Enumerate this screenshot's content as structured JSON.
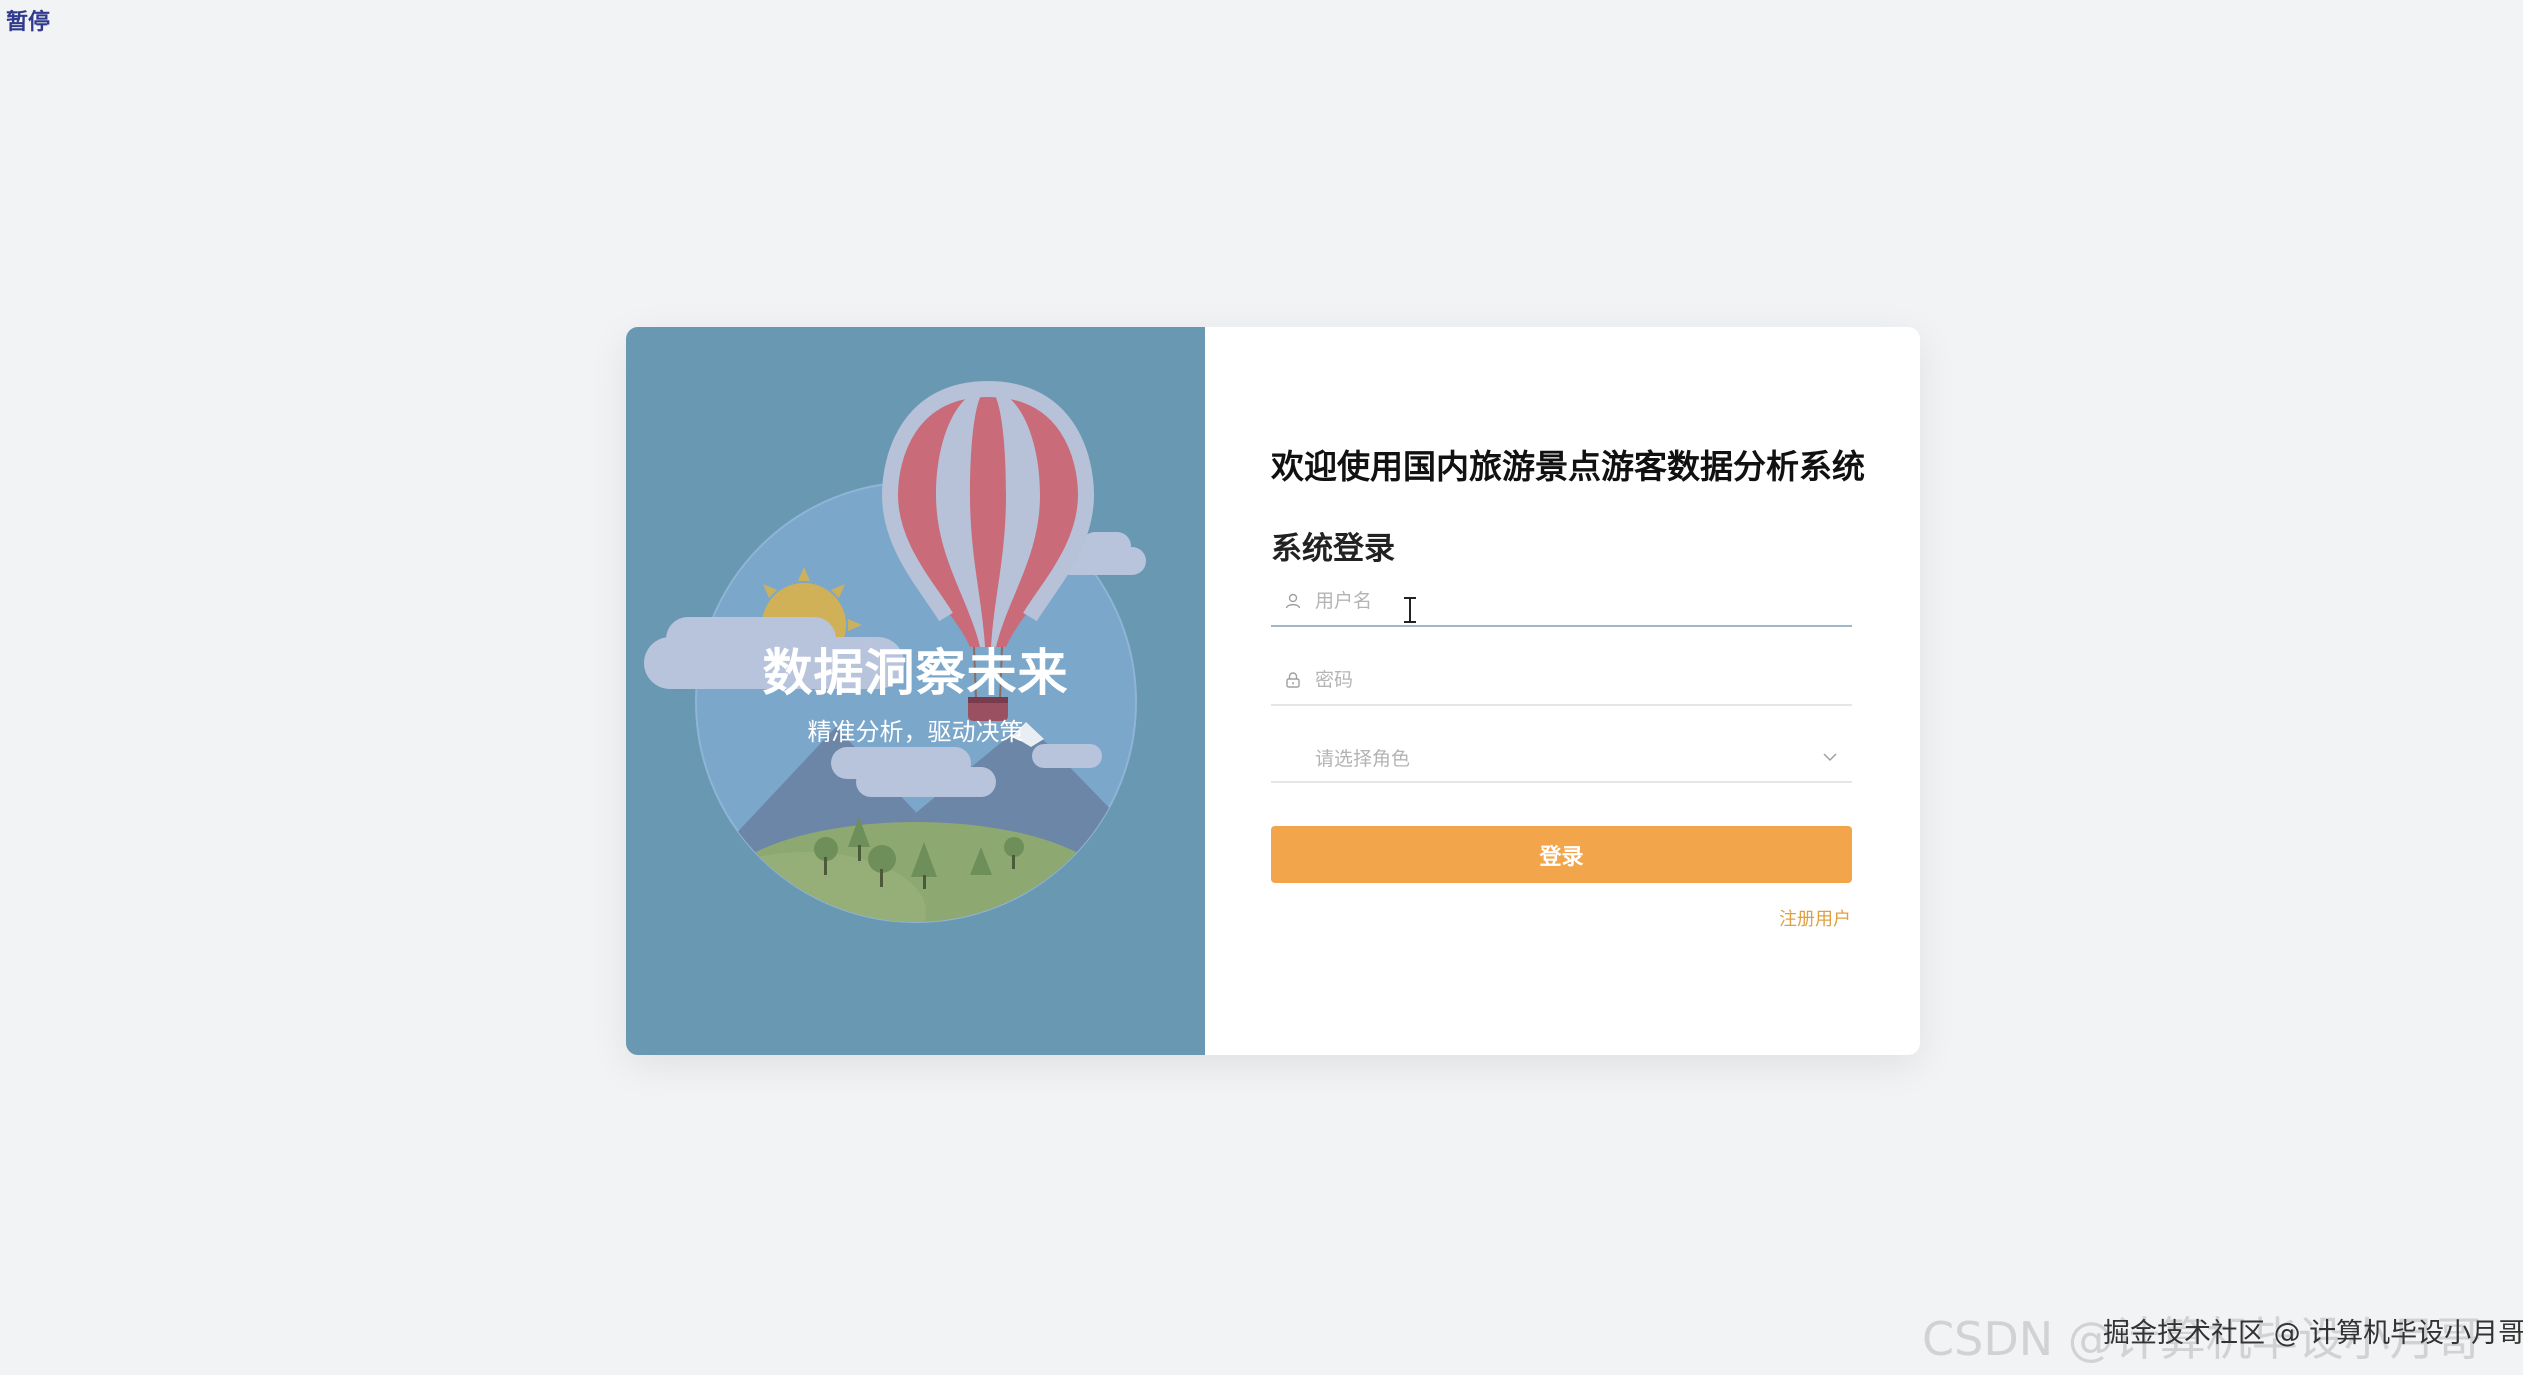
{
  "overlay": {
    "pause_label": "暂停"
  },
  "hero": {
    "title": "数据洞察未来",
    "subtitle": "精准分析，驱动决策"
  },
  "login": {
    "system_title": "欢迎使用国内旅游景点游客数据分析系统",
    "form_title": "系统登录",
    "username_placeholder": "用户名",
    "password_placeholder": "密码",
    "role_placeholder": "请选择角色",
    "submit_label": "登录",
    "register_link": "注册用户"
  },
  "watermarks": {
    "juejin": "掘金技术社区 @ 计算机毕设小月哥",
    "csdn": "CSDN @计算机毕设小月哥"
  },
  "colors": {
    "page_bg": "#f2f3f5",
    "illustration_bg": "#6898b2",
    "accent_button": "#f2a54a",
    "link": "#e0a040"
  },
  "icons": {
    "username": "user-icon",
    "password": "lock-icon",
    "role": "chevron-down-icon"
  }
}
